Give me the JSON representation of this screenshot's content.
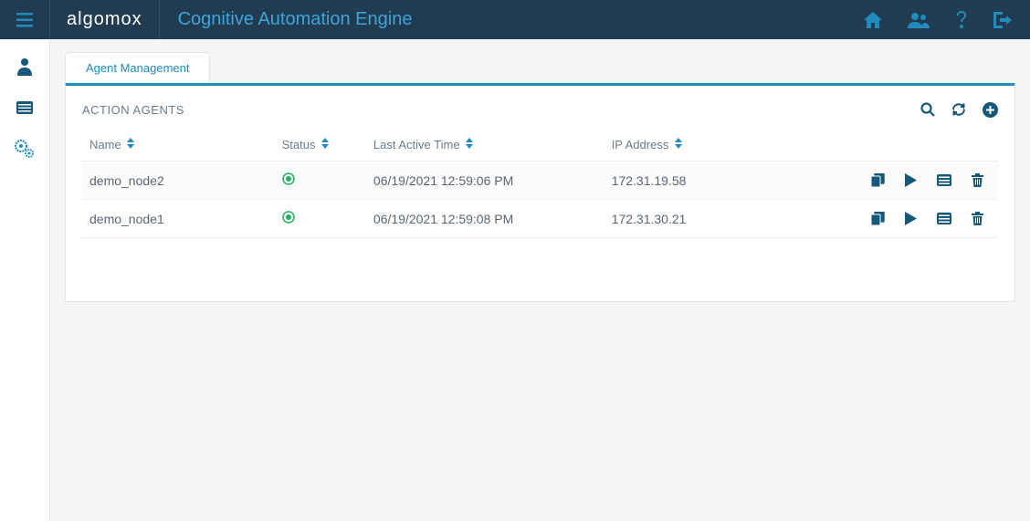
{
  "header": {
    "logo_text": "algomox",
    "title": "Cognitive Automation Engine"
  },
  "tabs": [
    {
      "label": "Agent Management"
    }
  ],
  "panel": {
    "title": "ACTION AGENTS",
    "columns": {
      "name": "Name",
      "status": "Status",
      "last_active": "Last Active Time",
      "ip": "IP Address"
    },
    "rows": [
      {
        "name": "demo_node2",
        "status": "active",
        "last_active": "06/19/2021 12:59:06 PM",
        "ip": "172.31.19.58"
      },
      {
        "name": "demo_node1",
        "status": "active",
        "last_active": "06/19/2021 12:59:08 PM",
        "ip": "172.31.30.21"
      }
    ]
  },
  "colors": {
    "accent": "#1f8bbf",
    "header_bg": "#213c50",
    "status_active": "#27ae60"
  }
}
